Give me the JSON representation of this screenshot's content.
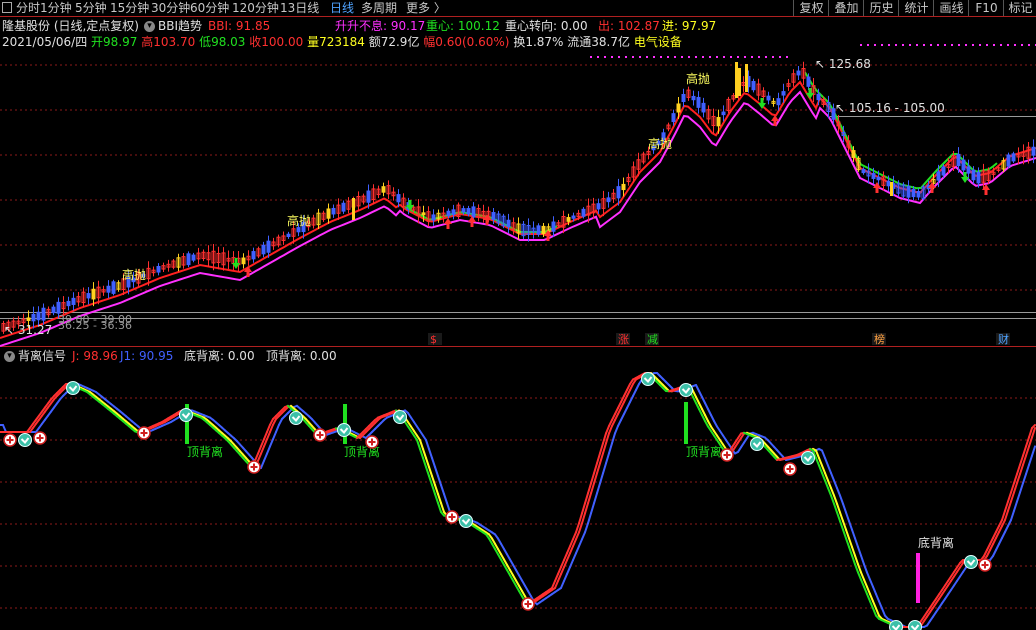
{
  "toolbar": {
    "periods": [
      "分时",
      "1分钟",
      "5分钟",
      "15分钟",
      "30分钟",
      "60分钟",
      "120分钟",
      "13日线",
      "日线",
      "多周期",
      "更多 〉"
    ],
    "active_period": "日线",
    "right_buttons": [
      "复权",
      "叠加",
      "历史",
      "统计",
      "画线",
      "F10",
      "标记"
    ]
  },
  "main_legend": {
    "stock": "隆基股份 (日线,定点复权)",
    "indicator": "BBI趋势",
    "bbi_label": "BBI: 91.85",
    "sheng_label": "升升不息: 90.17",
    "zhongxin_label": "重心: 100.12",
    "zhuanxiang_label": "重心转向: 0.00",
    "chu_label": "出: 102.87",
    "jin_label": "进: 97.97"
  },
  "quote": {
    "date": "2021/05/06/四",
    "open": "开98.97",
    "high": "高103.70",
    "low": "低98.03",
    "close": "收100.00",
    "volume": "量723184",
    "amount": "额72.9亿",
    "change": "幅0.60(0.60%)",
    "turnover": "换1.87%",
    "float_cap": "流通38.7亿",
    "sector": "电气设备"
  },
  "price_annotations": {
    "high_price": "125.68",
    "level_price": "105.16 - 105.00",
    "low_price": "31.27",
    "left_range_a": "39.00 - 39.00",
    "left_range_b": "36.25 - 36.36",
    "gaopao": "高抛"
  },
  "event_markers": [
    "$",
    "涨",
    "减",
    "榜",
    "财"
  ],
  "sub_legend": {
    "title": "背离信号",
    "j_label": "J: 98.96",
    "j1_label": "J1: 90.95",
    "di_label": "底背离: 0.00",
    "ding_label": "顶背离: 0.00"
  },
  "signals": {
    "top_divergence": "顶背离",
    "bottom_divergence": "底背离"
  },
  "colors": {
    "up": "#ff3030",
    "down": "#4060ff",
    "bbi_red": "#ff2020",
    "magenta": "#ff30ff",
    "green": "#20e020",
    "yellow": "#ffff20",
    "grid": "#8b1a1a"
  }
}
